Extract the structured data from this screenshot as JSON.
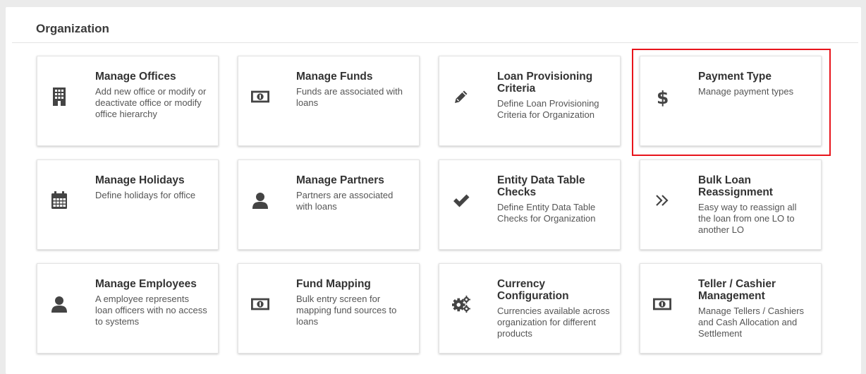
{
  "section": {
    "title": "Organization"
  },
  "cards": [
    {
      "title": "Manage Offices",
      "description": "Add new office or modify or deactivate office or modify office hierarchy",
      "icon": "building-icon"
    },
    {
      "title": "Manage Funds",
      "description": "Funds are associated with loans",
      "icon": "money-icon"
    },
    {
      "title": "Loan Provisioning Criteria",
      "description": "Define Loan Provisioning Criteria for Organization",
      "icon": "pencil-icon"
    },
    {
      "title": "Payment Type",
      "description": "Manage payment types",
      "icon": "dollar-icon"
    },
    {
      "title": "Manage Holidays",
      "description": "Define holidays for office",
      "icon": "calendar-icon"
    },
    {
      "title": "Manage Partners",
      "description": "Partners are associated with loans",
      "icon": "user-icon"
    },
    {
      "title": "Entity Data Table Checks",
      "description": "Define Entity Data Table Checks for Organization",
      "icon": "check-icon"
    },
    {
      "title": "Bulk Loan Reassignment",
      "description": "Easy way to reassign all the loan from one LO to another LO",
      "icon": "double-chevron-right-icon"
    },
    {
      "title": "Manage Employees",
      "description": "A employee represents loan officers with no access to systems",
      "icon": "user-icon"
    },
    {
      "title": "Fund Mapping",
      "description": "Bulk entry screen for mapping fund sources to loans",
      "icon": "money-icon"
    },
    {
      "title": "Currency Configuration",
      "description": "Currencies available across organization for different products",
      "icon": "gears-icon"
    },
    {
      "title": "Teller / Cashier Management",
      "description": "Manage Tellers / Cashiers and Cash Allocation and Settlement",
      "icon": "money-icon"
    }
  ],
  "colors": {
    "icon": "#444444",
    "highlight": "#e8141b",
    "background": "#ebebeb"
  }
}
